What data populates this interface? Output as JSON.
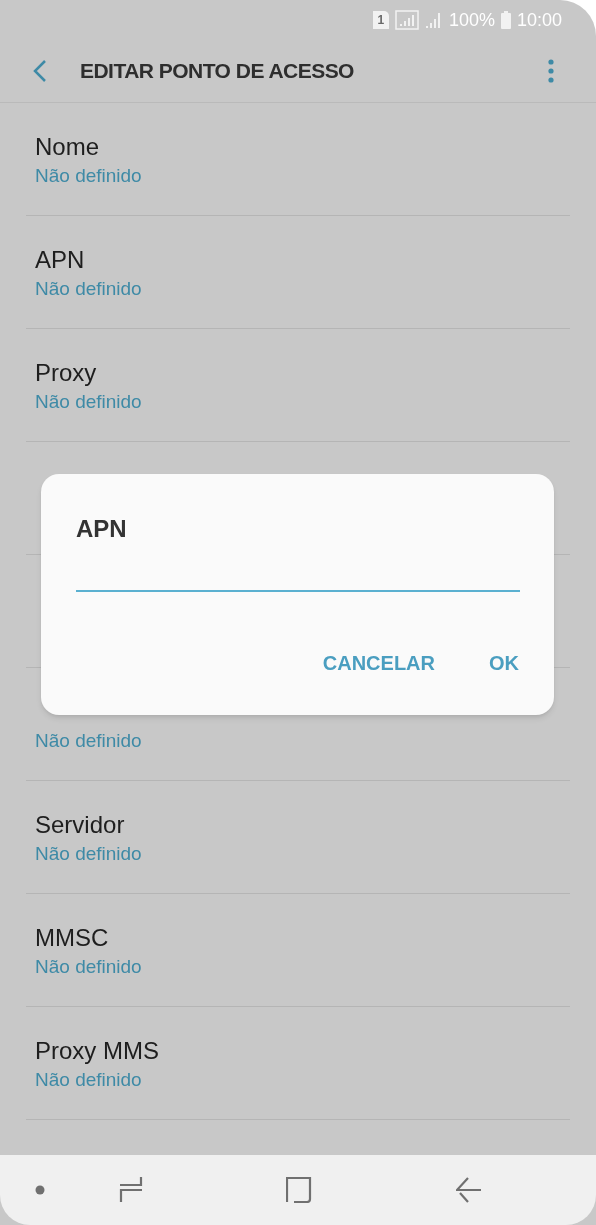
{
  "status_bar": {
    "sim": "1",
    "battery_text": "100%",
    "time": "10:00"
  },
  "header": {
    "title": "EDITAR PONTO DE ACESSO"
  },
  "settings": [
    {
      "kind": "setting",
      "title": "Nome",
      "value": "Não definido"
    },
    {
      "kind": "setting",
      "title": "APN",
      "value": "Não definido"
    },
    {
      "kind": "setting",
      "title": "Proxy",
      "value": "Não definido"
    },
    {
      "kind": "covered"
    },
    {
      "kind": "covered"
    },
    {
      "kind": "setting",
      "value": "Não definido"
    },
    {
      "kind": "setting",
      "title": "Servidor",
      "value": "Não definido"
    },
    {
      "kind": "setting",
      "title": "MMSC",
      "value": "Não definido"
    },
    {
      "kind": "setting",
      "title": "Proxy MMS",
      "value": "Não definido"
    }
  ],
  "dialog": {
    "title": "APN",
    "buttons": [
      "CANCELAR",
      "OK"
    ]
  }
}
